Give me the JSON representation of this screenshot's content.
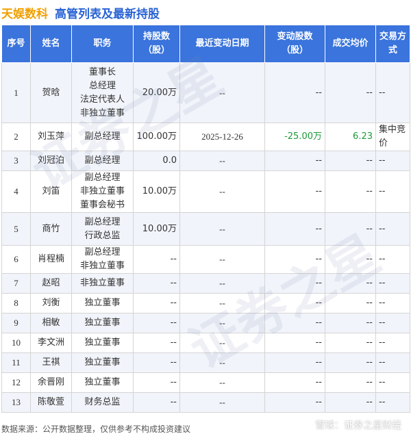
{
  "header": {
    "company": "天娱数科",
    "title": "高管列表及最新持股"
  },
  "table": {
    "columns": [
      "序号",
      "姓名",
      "职务",
      "持股数\n（股）",
      "最近变动日期",
      "变动股数\n（股）",
      "成交均价",
      "交易方式"
    ],
    "rows": [
      {
        "no": "1",
        "name": "贺晗",
        "roles": [
          "董事长",
          "总经理",
          "法定代表人",
          "非独立董事"
        ],
        "shares": "20.00万",
        "date": "--",
        "change": "--",
        "price": "--",
        "mode": "--"
      },
      {
        "no": "2",
        "name": "刘玉萍",
        "roles": [
          "副总经理"
        ],
        "shares": "100.00万",
        "date": "2025-12-26",
        "change": "-25.00万",
        "price": "6.23",
        "mode": "集中竞价"
      },
      {
        "no": "3",
        "name": "刘冠泊",
        "roles": [
          "副总经理"
        ],
        "shares": "0.0",
        "date": "--",
        "change": "--",
        "price": "--",
        "mode": "--"
      },
      {
        "no": "4",
        "name": "刘笛",
        "roles": [
          "副总经理",
          "非独立董事",
          "董事会秘书"
        ],
        "shares": "10.00万",
        "date": "--",
        "change": "--",
        "price": "--",
        "mode": "--"
      },
      {
        "no": "5",
        "name": "商竹",
        "roles": [
          "副总经理",
          "行政总监"
        ],
        "shares": "10.00万",
        "date": "--",
        "change": "--",
        "price": "--",
        "mode": "--"
      },
      {
        "no": "6",
        "name": "肖程楠",
        "roles": [
          "副总经理",
          "非独立董事"
        ],
        "shares": "--",
        "date": "--",
        "change": "--",
        "price": "--",
        "mode": "--"
      },
      {
        "no": "7",
        "name": "赵昭",
        "roles": [
          "非独立董事"
        ],
        "shares": "--",
        "date": "--",
        "change": "--",
        "price": "--",
        "mode": "--"
      },
      {
        "no": "8",
        "name": "刘衡",
        "roles": [
          "独立董事"
        ],
        "shares": "--",
        "date": "--",
        "change": "--",
        "price": "--",
        "mode": "--"
      },
      {
        "no": "9",
        "name": "相敏",
        "roles": [
          "独立董事"
        ],
        "shares": "--",
        "date": "--",
        "change": "--",
        "price": "--",
        "mode": "--"
      },
      {
        "no": "10",
        "name": "李文洲",
        "roles": [
          "独立董事"
        ],
        "shares": "--",
        "date": "--",
        "change": "--",
        "price": "--",
        "mode": "--"
      },
      {
        "no": "11",
        "name": "王祺",
        "roles": [
          "独立董事"
        ],
        "shares": "--",
        "date": "--",
        "change": "--",
        "price": "--",
        "mode": "--"
      },
      {
        "no": "12",
        "name": "余晋刚",
        "roles": [
          "独立董事"
        ],
        "shares": "--",
        "date": "--",
        "change": "--",
        "price": "--",
        "mode": "--"
      },
      {
        "no": "13",
        "name": "陈敬萱",
        "roles": [
          "财务总监"
        ],
        "shares": "--",
        "date": "--",
        "change": "--",
        "price": "--",
        "mode": "--"
      }
    ]
  },
  "footer": {
    "source": "数据来源：公开数据整理，仅供参考不构成投资建议",
    "brand": "雪球：证券之星财经"
  },
  "watermark": "证券之星",
  "colors": {
    "company": "#f0a000",
    "title": "#2a63d4",
    "header_bg": "#3a74dc",
    "row_alt_bg": "#f1f4fa",
    "change_value": "#1a9a3a"
  }
}
